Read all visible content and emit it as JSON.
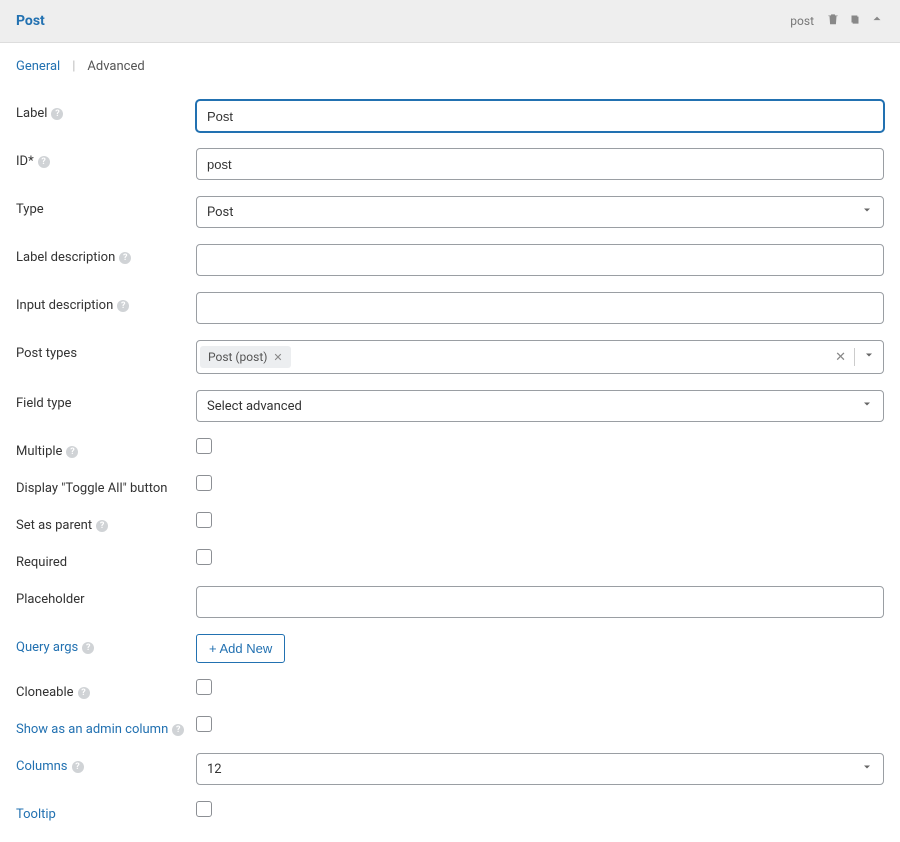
{
  "header": {
    "title": "Post",
    "type_slug": "post"
  },
  "tabs": {
    "general": "General",
    "advanced": "Advanced"
  },
  "fields": {
    "label": {
      "label": "Label",
      "value": "Post"
    },
    "id": {
      "label": "ID*",
      "value": "post"
    },
    "type": {
      "label": "Type",
      "value": "Post"
    },
    "label_desc": {
      "label": "Label description",
      "value": ""
    },
    "input_desc": {
      "label": "Input description",
      "value": ""
    },
    "post_types": {
      "label": "Post types",
      "tag": "Post (post)"
    },
    "field_type": {
      "label": "Field type",
      "value": "Select advanced"
    },
    "multiple": {
      "label": "Multiple"
    },
    "toggle_all": {
      "label": "Display \"Toggle All\" button"
    },
    "set_parent": {
      "label": "Set as parent"
    },
    "required": {
      "label": "Required"
    },
    "placeholder": {
      "label": "Placeholder",
      "value": ""
    },
    "query_args": {
      "label": "Query args",
      "button": "+ Add New"
    },
    "cloneable": {
      "label": "Cloneable"
    },
    "admin_col": {
      "label": "Show as an admin column"
    },
    "columns": {
      "label": "Columns",
      "value": "12"
    },
    "tooltip": {
      "label": "Tooltip"
    }
  }
}
